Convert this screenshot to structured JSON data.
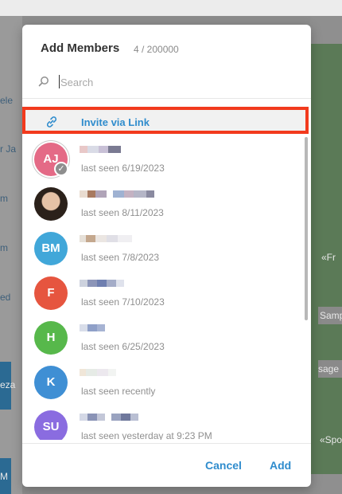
{
  "background_fragments": [
    "ele",
    "r Ja",
    "m",
    "m",
    "ed",
    "«Fr",
    "Samp",
    "sage",
    "«Spo",
    "eza",
    "M"
  ],
  "dialog": {
    "title": "Add Members",
    "count": "4 / 200000",
    "search_placeholder": "Search",
    "invite_label": "Invite via Link",
    "cancel_label": "Cancel",
    "add_label": "Add"
  },
  "members": [
    {
      "initials": "AJ",
      "color": "#e46a86",
      "status": "last seen 6/19/2023",
      "selected": true
    },
    {
      "initials": "",
      "color": "#3a2a20",
      "status": "last seen 8/11/2023",
      "photo": true
    },
    {
      "initials": "BM",
      "color": "#41a7d9",
      "status": "last seen 7/8/2023"
    },
    {
      "initials": "F",
      "color": "#e6553f",
      "status": "last seen 7/10/2023"
    },
    {
      "initials": "H",
      "color": "#57b84b",
      "status": "last seen 6/25/2023"
    },
    {
      "initials": "K",
      "color": "#3f8fd4",
      "status": "last seen recently"
    },
    {
      "initials": "SU",
      "color": "#8a6ce0",
      "status": "last seen yesterday at 9:23 PM"
    }
  ],
  "colors": {
    "accent": "#2f8ccd",
    "highlight_border": "#f23a1d"
  }
}
